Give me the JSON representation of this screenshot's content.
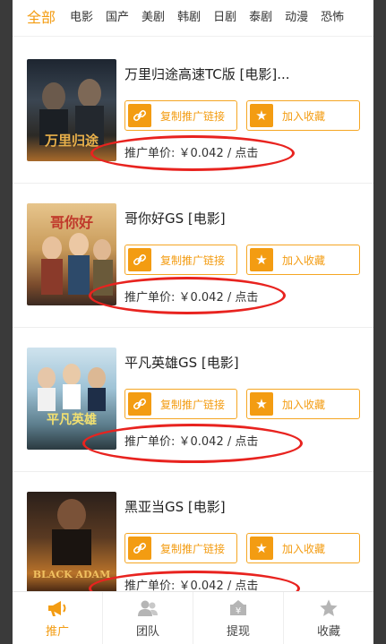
{
  "tabs": [
    "全部",
    "电影",
    "国产",
    "美剧",
    "韩剧",
    "日剧",
    "泰剧",
    "动漫",
    "恐怖"
  ],
  "copy_label": "复制推广链接",
  "fav_label": "加入收藏",
  "items": [
    {
      "title": "万里归途高速TC版 [电影]...",
      "price": "推广单价: ￥0.042 / 点击",
      "poster_text": "万里归途"
    },
    {
      "title": "哥你好GS [电影]",
      "price": "推广单价: ￥0.042 / 点击",
      "poster_text": "哥你好"
    },
    {
      "title": "平凡英雄GS [电影]",
      "price": "推广单价: ￥0.042 / 点击",
      "poster_text": "平凡英雄"
    },
    {
      "title": "黑亚当GS [电影]",
      "price": "推广单价: ￥0.042 / 点击",
      "poster_text": "BLACK ADAM"
    }
  ],
  "bottom_nav": [
    {
      "label": "推广",
      "icon": "megaphone-icon"
    },
    {
      "label": "团队",
      "icon": "team-icon"
    },
    {
      "label": "提现",
      "icon": "withdraw-icon"
    },
    {
      "label": "收藏",
      "icon": "star-icon"
    }
  ],
  "colors": {
    "accent": "#f39c12",
    "annotation": "#e8231f"
  }
}
